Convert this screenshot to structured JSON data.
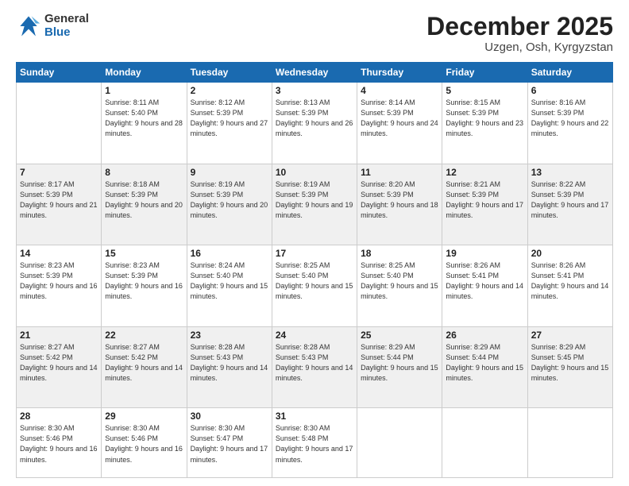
{
  "logo": {
    "general": "General",
    "blue": "Blue"
  },
  "header": {
    "month": "December 2025",
    "location": "Uzgen, Osh, Kyrgyzstan"
  },
  "weekdays": [
    "Sunday",
    "Monday",
    "Tuesday",
    "Wednesday",
    "Thursday",
    "Friday",
    "Saturday"
  ],
  "weeks": [
    [
      {
        "day": "",
        "sunrise": "",
        "sunset": "",
        "daylight": ""
      },
      {
        "day": "1",
        "sunrise": "Sunrise: 8:11 AM",
        "sunset": "Sunset: 5:40 PM",
        "daylight": "Daylight: 9 hours and 28 minutes."
      },
      {
        "day": "2",
        "sunrise": "Sunrise: 8:12 AM",
        "sunset": "Sunset: 5:39 PM",
        "daylight": "Daylight: 9 hours and 27 minutes."
      },
      {
        "day": "3",
        "sunrise": "Sunrise: 8:13 AM",
        "sunset": "Sunset: 5:39 PM",
        "daylight": "Daylight: 9 hours and 26 minutes."
      },
      {
        "day": "4",
        "sunrise": "Sunrise: 8:14 AM",
        "sunset": "Sunset: 5:39 PM",
        "daylight": "Daylight: 9 hours and 24 minutes."
      },
      {
        "day": "5",
        "sunrise": "Sunrise: 8:15 AM",
        "sunset": "Sunset: 5:39 PM",
        "daylight": "Daylight: 9 hours and 23 minutes."
      },
      {
        "day": "6",
        "sunrise": "Sunrise: 8:16 AM",
        "sunset": "Sunset: 5:39 PM",
        "daylight": "Daylight: 9 hours and 22 minutes."
      }
    ],
    [
      {
        "day": "7",
        "sunrise": "Sunrise: 8:17 AM",
        "sunset": "Sunset: 5:39 PM",
        "daylight": "Daylight: 9 hours and 21 minutes."
      },
      {
        "day": "8",
        "sunrise": "Sunrise: 8:18 AM",
        "sunset": "Sunset: 5:39 PM",
        "daylight": "Daylight: 9 hours and 20 minutes."
      },
      {
        "day": "9",
        "sunrise": "Sunrise: 8:19 AM",
        "sunset": "Sunset: 5:39 PM",
        "daylight": "Daylight: 9 hours and 20 minutes."
      },
      {
        "day": "10",
        "sunrise": "Sunrise: 8:19 AM",
        "sunset": "Sunset: 5:39 PM",
        "daylight": "Daylight: 9 hours and 19 minutes."
      },
      {
        "day": "11",
        "sunrise": "Sunrise: 8:20 AM",
        "sunset": "Sunset: 5:39 PM",
        "daylight": "Daylight: 9 hours and 18 minutes."
      },
      {
        "day": "12",
        "sunrise": "Sunrise: 8:21 AM",
        "sunset": "Sunset: 5:39 PM",
        "daylight": "Daylight: 9 hours and 17 minutes."
      },
      {
        "day": "13",
        "sunrise": "Sunrise: 8:22 AM",
        "sunset": "Sunset: 5:39 PM",
        "daylight": "Daylight: 9 hours and 17 minutes."
      }
    ],
    [
      {
        "day": "14",
        "sunrise": "Sunrise: 8:23 AM",
        "sunset": "Sunset: 5:39 PM",
        "daylight": "Daylight: 9 hours and 16 minutes."
      },
      {
        "day": "15",
        "sunrise": "Sunrise: 8:23 AM",
        "sunset": "Sunset: 5:39 PM",
        "daylight": "Daylight: 9 hours and 16 minutes."
      },
      {
        "day": "16",
        "sunrise": "Sunrise: 8:24 AM",
        "sunset": "Sunset: 5:40 PM",
        "daylight": "Daylight: 9 hours and 15 minutes."
      },
      {
        "day": "17",
        "sunrise": "Sunrise: 8:25 AM",
        "sunset": "Sunset: 5:40 PM",
        "daylight": "Daylight: 9 hours and 15 minutes."
      },
      {
        "day": "18",
        "sunrise": "Sunrise: 8:25 AM",
        "sunset": "Sunset: 5:40 PM",
        "daylight": "Daylight: 9 hours and 15 minutes."
      },
      {
        "day": "19",
        "sunrise": "Sunrise: 8:26 AM",
        "sunset": "Sunset: 5:41 PM",
        "daylight": "Daylight: 9 hours and 14 minutes."
      },
      {
        "day": "20",
        "sunrise": "Sunrise: 8:26 AM",
        "sunset": "Sunset: 5:41 PM",
        "daylight": "Daylight: 9 hours and 14 minutes."
      }
    ],
    [
      {
        "day": "21",
        "sunrise": "Sunrise: 8:27 AM",
        "sunset": "Sunset: 5:42 PM",
        "daylight": "Daylight: 9 hours and 14 minutes."
      },
      {
        "day": "22",
        "sunrise": "Sunrise: 8:27 AM",
        "sunset": "Sunset: 5:42 PM",
        "daylight": "Daylight: 9 hours and 14 minutes."
      },
      {
        "day": "23",
        "sunrise": "Sunrise: 8:28 AM",
        "sunset": "Sunset: 5:43 PM",
        "daylight": "Daylight: 9 hours and 14 minutes."
      },
      {
        "day": "24",
        "sunrise": "Sunrise: 8:28 AM",
        "sunset": "Sunset: 5:43 PM",
        "daylight": "Daylight: 9 hours and 14 minutes."
      },
      {
        "day": "25",
        "sunrise": "Sunrise: 8:29 AM",
        "sunset": "Sunset: 5:44 PM",
        "daylight": "Daylight: 9 hours and 15 minutes."
      },
      {
        "day": "26",
        "sunrise": "Sunrise: 8:29 AM",
        "sunset": "Sunset: 5:44 PM",
        "daylight": "Daylight: 9 hours and 15 minutes."
      },
      {
        "day": "27",
        "sunrise": "Sunrise: 8:29 AM",
        "sunset": "Sunset: 5:45 PM",
        "daylight": "Daylight: 9 hours and 15 minutes."
      }
    ],
    [
      {
        "day": "28",
        "sunrise": "Sunrise: 8:30 AM",
        "sunset": "Sunset: 5:46 PM",
        "daylight": "Daylight: 9 hours and 16 minutes."
      },
      {
        "day": "29",
        "sunrise": "Sunrise: 8:30 AM",
        "sunset": "Sunset: 5:46 PM",
        "daylight": "Daylight: 9 hours and 16 minutes."
      },
      {
        "day": "30",
        "sunrise": "Sunrise: 8:30 AM",
        "sunset": "Sunset: 5:47 PM",
        "daylight": "Daylight: 9 hours and 17 minutes."
      },
      {
        "day": "31",
        "sunrise": "Sunrise: 8:30 AM",
        "sunset": "Sunset: 5:48 PM",
        "daylight": "Daylight: 9 hours and 17 minutes."
      },
      {
        "day": "",
        "sunrise": "",
        "sunset": "",
        "daylight": ""
      },
      {
        "day": "",
        "sunrise": "",
        "sunset": "",
        "daylight": ""
      },
      {
        "day": "",
        "sunrise": "",
        "sunset": "",
        "daylight": ""
      }
    ]
  ]
}
